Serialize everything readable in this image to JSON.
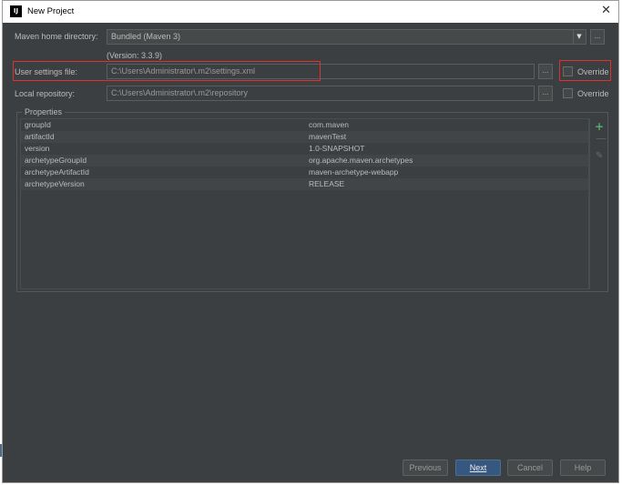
{
  "window": {
    "title": "New Project",
    "app_icon_text": "IJ",
    "close_glyph": "✕"
  },
  "maven_home": {
    "label": "Maven home directory:",
    "value": "Bundled (Maven 3)",
    "version": "(Version: 3.3.9)",
    "browse": "..."
  },
  "user_settings": {
    "label": "User settings file:",
    "value": "C:\\Users\\Administrator\\.m2\\settings.xml",
    "browse": "...",
    "override_label": "Override",
    "override_checked": false
  },
  "local_repo": {
    "label": "Local repository:",
    "value": "C:\\Users\\Administrator\\.m2\\repository",
    "browse": "...",
    "override_label": "Override",
    "override_checked": false
  },
  "properties": {
    "legend": "Properties",
    "add_glyph": "+",
    "remove_glyph": "—",
    "edit_glyph": "✎",
    "rows": [
      {
        "key": "groupId",
        "value": "com.maven"
      },
      {
        "key": "artifactId",
        "value": "mavenTest"
      },
      {
        "key": "version",
        "value": "1.0-SNAPSHOT"
      },
      {
        "key": "archetypeGroupId",
        "value": "org.apache.maven.archetypes"
      },
      {
        "key": "archetypeArtifactId",
        "value": "maven-archetype-webapp"
      },
      {
        "key": "archetypeVersion",
        "value": "RELEASE"
      }
    ]
  },
  "buttons": {
    "previous": "Previous",
    "next": "Next",
    "cancel": "Cancel",
    "help": "Help"
  },
  "colors": {
    "background": "#3c3f41",
    "highlight": "#e0312b",
    "primary_button": "#365880",
    "add_icon": "#59a869"
  }
}
